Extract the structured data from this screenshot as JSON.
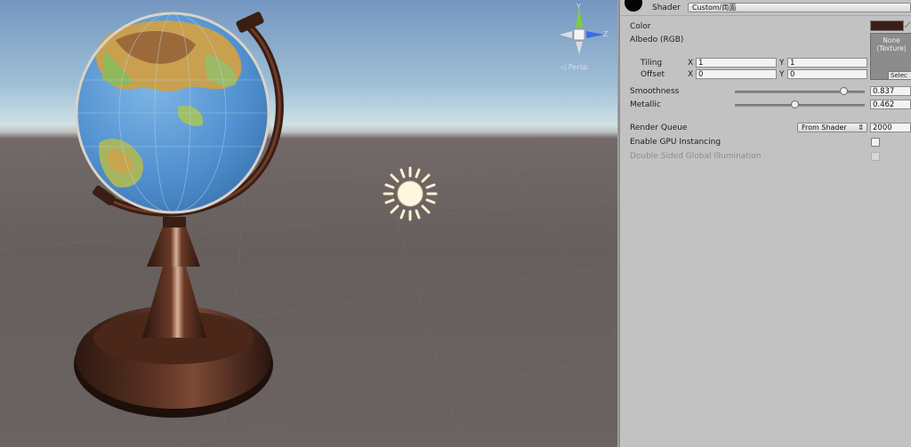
{
  "scene": {
    "gizmo": {
      "y_label": "Y",
      "z_label": "Z",
      "mode_label": "◁ Persp"
    }
  },
  "inspector": {
    "shader": {
      "label": "Shader",
      "value": "Custom/両面"
    },
    "color": {
      "label": "Color",
      "swatch_color": "#3a1f16"
    },
    "albedo": {
      "label": "Albedo (RGB)",
      "texture_slot": "None\n(Texture)",
      "select_label": "Selec"
    },
    "tiling": {
      "label": "Tiling",
      "x_label": "X",
      "x": "1",
      "y_label": "Y",
      "y": "1"
    },
    "offset": {
      "label": "Offset",
      "x_label": "X",
      "x": "0",
      "y_label": "Y",
      "y": "0"
    },
    "smoothness": {
      "label": "Smoothness",
      "value": "0.837",
      "level": 0.837
    },
    "metallic": {
      "label": "Metallic",
      "value": "0.462",
      "level": 0.462
    },
    "render_queue": {
      "label": "Render Queue",
      "dropdown": "From Shader",
      "value": "2000"
    },
    "gpu_instancing": {
      "label": "Enable GPU Instancing"
    },
    "double_sided_gi": {
      "label": "Double Sided Global Illumination"
    }
  }
}
